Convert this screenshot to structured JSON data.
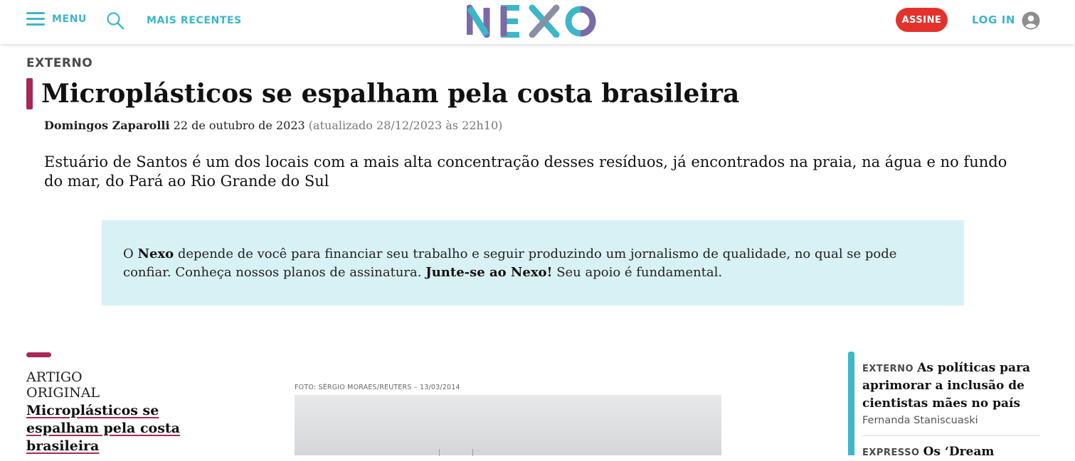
{
  "header": {
    "menu_label": "MENU",
    "recent_label": "MAIS RECENTES",
    "logo_text": "NEXO",
    "subscribe_label": "ASSINE",
    "login_label": "LOG IN",
    "colors": {
      "accent": "#3db6c9",
      "subscribe": "#e3322b",
      "logo_purple": "#7b6aa8",
      "logo_teal": "#3db6c9",
      "logo_gray": "#8b8fa3"
    }
  },
  "article": {
    "section": "EXTERNO",
    "title": "Microplásticos se espalham pela costa brasileira",
    "author": "Domingos Zaparolli",
    "date": "22 de outubro de 2023",
    "updated": "(atualizado 28/12/2023 às 22h10)",
    "dek": "Estuário de Santos é um dos locais com a mais alta concentração desses resíduos, já encontrados na praia, na água e no fundo do mar, do Pará ao Rio Grande do Sul",
    "title_bar_color": "#a82858"
  },
  "support_box": {
    "part1": "O ",
    "brand": "Nexo",
    "part2": " depende de você para financiar seu trabalho e seguir produzindo um jornalismo de qualidade, no qual se pode confiar. Conheça nossos planos de assinatura. ",
    "cta": "Junte-se ao Nexo!",
    "part3": " Seu apoio é fundamental.",
    "background": "#d8f1f4"
  },
  "left_column": {
    "kind": "ARTIGO ORIGINAL",
    "title": "Microplásticos se espalham pela costa brasileira"
  },
  "photo": {
    "credit": "FOTO: SÉRGIO MORAES/REUTERS – 13/03/2014"
  },
  "related": [
    {
      "tag": "EXTERNO",
      "title": "As políticas para aprimorar a inclusão de cientistas mães no país",
      "author": "Fernanda Staniscuaski"
    },
    {
      "tag": "EXPRESSO",
      "title": "Os ‘Dream"
    }
  ]
}
